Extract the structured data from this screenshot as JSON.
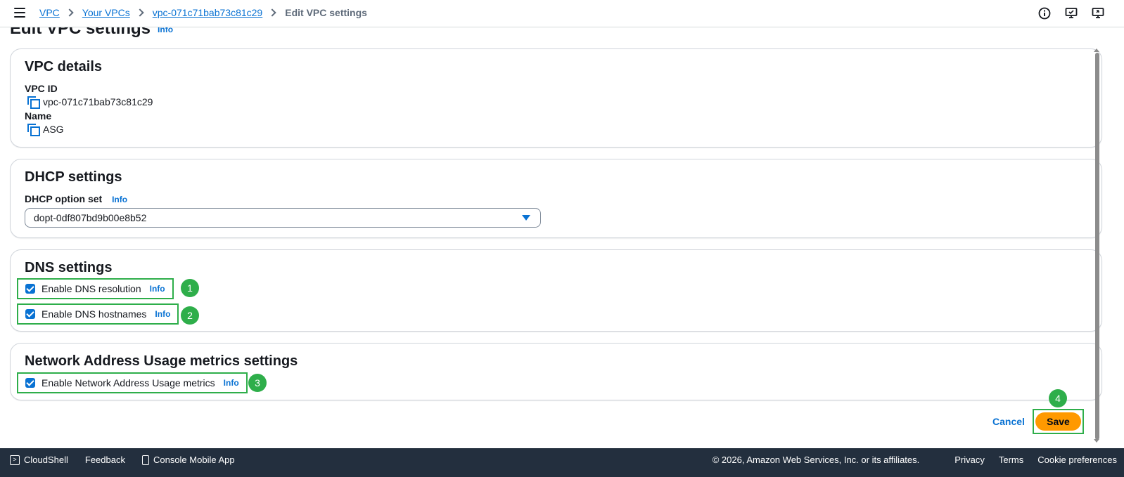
{
  "breadcrumb": {
    "items": [
      "VPC",
      "Your VPCs",
      "vpc-071c71bab73c81c29"
    ],
    "current": "Edit VPC settings"
  },
  "page": {
    "title": "Edit VPC settings",
    "info": "Info"
  },
  "vpc_details": {
    "heading": "VPC details",
    "id_label": "VPC ID",
    "id_value": "vpc-071c71bab73c81c29",
    "name_label": "Name",
    "name_value": "ASG"
  },
  "dhcp": {
    "heading": "DHCP settings",
    "option_label": "DHCP option set",
    "info": "Info",
    "selected": "dopt-0df807bd9b00e8b52"
  },
  "dns": {
    "heading": "DNS settings",
    "resolution_label": "Enable DNS resolution",
    "resolution_checked": true,
    "hostnames_label": "Enable DNS hostnames",
    "hostnames_checked": true,
    "info": "Info"
  },
  "nau": {
    "heading": "Network Address Usage metrics settings",
    "label": "Enable Network Address Usage metrics",
    "checked": true,
    "info": "Info"
  },
  "annotations": [
    "1",
    "2",
    "3",
    "4"
  ],
  "actions": {
    "cancel": "Cancel",
    "save": "Save"
  },
  "footer": {
    "cloudshell": "CloudShell",
    "feedback": "Feedback",
    "mobile_app": "Console Mobile App",
    "copyright": "© 2026, Amazon Web Services, Inc. or its affiliates.",
    "privacy": "Privacy",
    "terms": "Terms",
    "cookies": "Cookie preferences"
  },
  "colors": {
    "link": "#0972d3",
    "primary_button": "#ff9900",
    "annotation": "#2eae4a",
    "footer_bg": "#232f3e"
  },
  "icons": [
    "menu-icon",
    "info-icon",
    "screen-feedback-icon",
    "screen-share-icon",
    "copy-icon",
    "chevron-right-icon",
    "caret-down-icon",
    "check-icon",
    "terminal-icon",
    "mobile-icon"
  ]
}
